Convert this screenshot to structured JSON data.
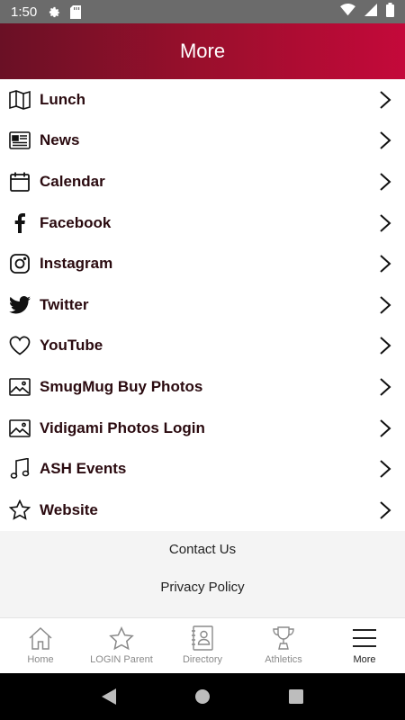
{
  "status_bar": {
    "time": "1:50",
    "icons": [
      "settings-icon",
      "sd-card-icon",
      "wifi-icon",
      "signal-icon",
      "battery-icon"
    ]
  },
  "header": {
    "title": "More"
  },
  "menu": {
    "items": [
      {
        "label": "Lunch",
        "icon": "map-icon"
      },
      {
        "label": "News",
        "icon": "newspaper-icon"
      },
      {
        "label": "Calendar",
        "icon": "calendar-icon"
      },
      {
        "label": "Facebook",
        "icon": "facebook-icon"
      },
      {
        "label": "Instagram",
        "icon": "instagram-icon"
      },
      {
        "label": "Twitter",
        "icon": "twitter-icon"
      },
      {
        "label": "YouTube",
        "icon": "heart-icon"
      },
      {
        "label": "SmugMug Buy Photos",
        "icon": "image-icon"
      },
      {
        "label": "Vidigami Photos Login",
        "icon": "image-icon"
      },
      {
        "label": "ASH Events",
        "icon": "music-note-icon"
      },
      {
        "label": "Website",
        "icon": "star-icon"
      }
    ]
  },
  "footer_links": {
    "contact": "Contact Us",
    "privacy": "Privacy Policy"
  },
  "bottom_nav": {
    "tabs": [
      {
        "label": "Home",
        "icon": "home-icon"
      },
      {
        "label": "LOGIN Parent",
        "icon": "star-outline-icon"
      },
      {
        "label": "Directory",
        "icon": "directory-icon"
      },
      {
        "label": "Athletics",
        "icon": "trophy-icon"
      },
      {
        "label": "More",
        "icon": "menu-icon",
        "active": true
      }
    ]
  },
  "colors": {
    "header_gradient_start": "#6a1025",
    "header_gradient_end": "#c4093a",
    "menu_text": "#2a0a0f",
    "status_bar": "#6b6b6b"
  }
}
